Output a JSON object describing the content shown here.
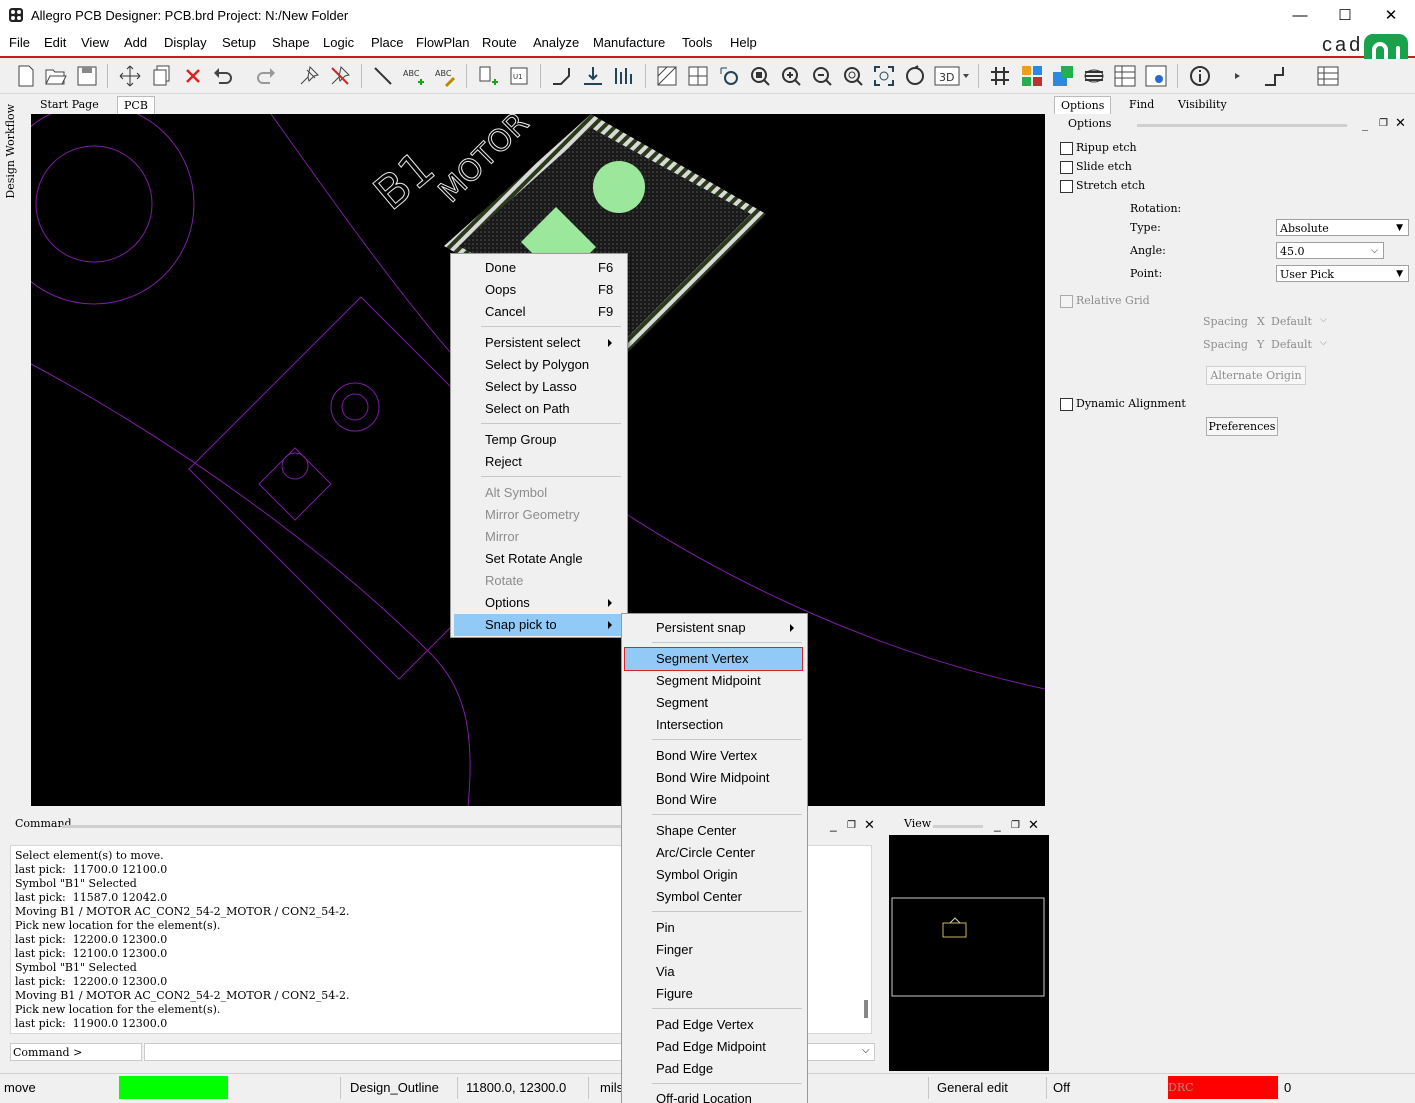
{
  "window": {
    "title": "Allegro PCB Designer: PCB.brd  Project: N:/New Folder",
    "minimize": "—",
    "maximize": "☐",
    "close": "✕"
  },
  "menubar": {
    "items": [
      "File",
      "Edit",
      "View",
      "Add",
      "Display",
      "Setup",
      "Shape",
      "Logic",
      "Place",
      "FlowPlan",
      "Route",
      "Analyze",
      "Manufacture",
      "Tools",
      "Help"
    ],
    "brand": "cade"
  },
  "left_tab": "Design Workflow",
  "doc_tabs": [
    "Start Page",
    "PCB"
  ],
  "canvas": {
    "refdes": "B1",
    "value_text": "MOTOR",
    "colors": {
      "outline": "#7b1fa2",
      "board_bg": "#000000",
      "pad": "#9be79b",
      "hatch": "#d9d9d9"
    }
  },
  "context_menu": {
    "items": [
      {
        "label": "Done",
        "shortcut": "F6"
      },
      {
        "label": "Oops",
        "shortcut": "F8"
      },
      {
        "label": "Cancel",
        "shortcut": "F9"
      },
      {
        "label": "Persistent select"
      },
      {
        "label": "Select by Polygon"
      },
      {
        "label": "Select by Lasso"
      },
      {
        "label": "Select on Path"
      },
      {
        "label": "Temp Group"
      },
      {
        "label": "Reject"
      },
      {
        "label": "Alt Symbol",
        "disabled": true
      },
      {
        "label": "Mirror Geometry",
        "disabled": true
      },
      {
        "label": "Mirror",
        "disabled": true
      },
      {
        "label": "Set Rotate Angle"
      },
      {
        "label": "Rotate",
        "disabled": true
      },
      {
        "label": "Options"
      },
      {
        "label": "Snap pick to",
        "highlighted": true
      }
    ]
  },
  "snap_menu": {
    "items": [
      {
        "label": "Persistent snap"
      },
      {
        "label": "Segment Vertex",
        "highlighted": true
      },
      {
        "label": "Segment Midpoint"
      },
      {
        "label": "Segment"
      },
      {
        "label": "Intersection"
      },
      {
        "label": "Bond Wire Vertex"
      },
      {
        "label": "Bond Wire Midpoint"
      },
      {
        "label": "Bond Wire"
      },
      {
        "label": "Shape Center"
      },
      {
        "label": "Arc/Circle Center"
      },
      {
        "label": "Symbol Origin"
      },
      {
        "label": "Symbol Center"
      },
      {
        "label": "Pin"
      },
      {
        "label": "Finger"
      },
      {
        "label": "Via"
      },
      {
        "label": "Figure"
      },
      {
        "label": "Pad Edge Vertex"
      },
      {
        "label": "Pad Edge Midpoint"
      },
      {
        "label": "Pad Edge"
      },
      {
        "label": "Off-grid Location"
      }
    ]
  },
  "options_panel": {
    "tabs": [
      "Options",
      "Find",
      "Visibility"
    ],
    "header": "Options",
    "ripup_etch": "Ripup etch",
    "slide_etch": "Slide etch",
    "stretch_etch": "Stretch etch",
    "rotation": "Rotation:",
    "type_label": "Type:",
    "type_value": "Absolute",
    "angle_label": "Angle:",
    "angle_value": "45.0",
    "point_label": "Point:",
    "point_value": "User Pick",
    "relative_grid": "Relative Grid",
    "spacing_x_label": "Spacing",
    "spacing_x_axis": "X",
    "spacing_x_value": "Default",
    "spacing_y_label": "Spacing",
    "spacing_y_axis": "Y",
    "spacing_y_value": "Default",
    "alternate_origin": "Alternate Origin",
    "dynamic_alignment": "Dynamic Alignment",
    "preferences": "Preferences"
  },
  "command_panel": {
    "title": "Command",
    "lines": [
      "Select element(s) to move.",
      "last pick:  11700.0 12100.0",
      "Symbol \"B1\" Selected",
      "last pick:  11587.0 12042.0",
      "Moving B1 / MOTOR AC_CON2_54-2_MOTOR / CON2_54-2.",
      "Pick new location for the element(s).",
      "last pick:  12200.0 12300.0",
      "last pick:  12100.0 12300.0",
      "Symbol \"B1\" Selected",
      "last pick:  12200.0 12300.0",
      "Moving B1 / MOTOR AC_CON2_54-2_MOTOR / CON2_54-2.",
      "Pick new location for the element(s).",
      "last pick:  11900.0 12300.0"
    ],
    "prompt": "Command >"
  },
  "view_panel": {
    "title": "View"
  },
  "statusbar": {
    "command": "move",
    "idle_color": "#00ff00",
    "class": "Design_Outline",
    "coords": "11800.0, 12300.0",
    "units": "mils",
    "mode": "General edit",
    "off": "Off",
    "drc_label": "DRC",
    "drc_color": "#ff0000",
    "drc_count": "0"
  }
}
